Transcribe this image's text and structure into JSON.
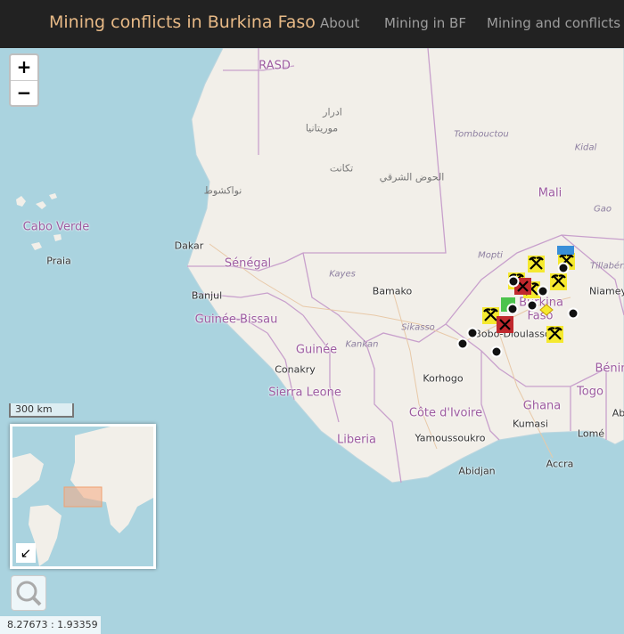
{
  "navbar": {
    "brand": "Mining conflicts in Burkina Faso",
    "links": [
      "About",
      "Mining in BF",
      "Mining and conflicts"
    ]
  },
  "map": {
    "zoom_in_label": "+",
    "zoom_out_label": "−",
    "scale_label": "300 km",
    "coordinates_text": "8.27673 : 1.93359",
    "minimap_toggle_icon": "arrow-down-left-icon",
    "search_icon": "magnifier-icon",
    "countries": [
      "RASD",
      "Mali",
      "Sénégal",
      "Guinée-Bissau",
      "Guinée",
      "Sierra Leone",
      "Liberia",
      "Côte d'Ivoire",
      "Ghana",
      "Togo",
      "Bénin",
      "Burkina",
      "Faso",
      "Cabo Verde"
    ],
    "cities": [
      "Dakar",
      "Banjul",
      "Bamako",
      "Conakry",
      "Korhogo",
      "Yamoussoukro",
      "Abidjan",
      "Kumasi",
      "Accra",
      "Lomé",
      "Bobo-Dioulasso",
      "Niamey",
      "Praia",
      "نواكشوط",
      "Tombouctou",
      "Kidal",
      "Gao",
      "Tillabéri",
      "Mopti",
      "Kayes",
      "Sikasso",
      "Kankan",
      "Ab"
    ],
    "arabic_labels": [
      "ادرار",
      "موريتانيا",
      "تكانت",
      "الحوض الشرقي"
    ],
    "marker_types": [
      "mining-site",
      "conflict-event",
      "artisanal-mine",
      "industrial-mine",
      "protest"
    ],
    "colors": {
      "sea": "#aad3df",
      "land": "#f2efe9",
      "border": "#c8a0cc",
      "navbar": "#222222",
      "brand": "#e7b986",
      "mine_yellow": "#f5e92f",
      "conflict_red": "#c0282d",
      "green": "#4cc34c",
      "blue": "#3a8fd8"
    }
  }
}
